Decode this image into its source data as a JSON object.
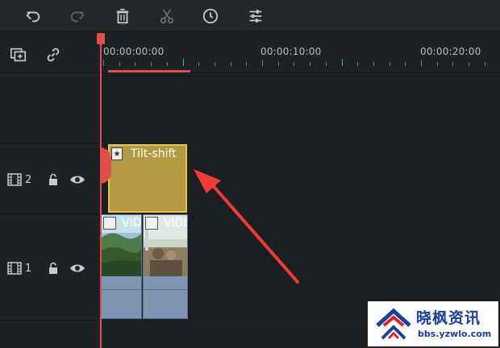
{
  "toolbar": {
    "buttons": [
      {
        "name": "undo-icon"
      },
      {
        "name": "redo-icon"
      },
      {
        "name": "delete-icon"
      },
      {
        "name": "cut-icon"
      },
      {
        "name": "duration-icon"
      },
      {
        "name": "adjust-icon"
      }
    ]
  },
  "timeline": {
    "timecodes": [
      "00:00:00:00",
      "00:00:10:00",
      "00:00:20:00"
    ],
    "tracks": [
      {
        "number": "2"
      },
      {
        "number": "1"
      }
    ],
    "effect_clip": {
      "label": "Tilt-shift"
    },
    "video_clips": [
      {
        "label": "VIDEO"
      },
      {
        "label": "VIDEO"
      }
    ]
  },
  "watermark": {
    "title": "晓枫资讯",
    "url": "bbs.yzwlo.com"
  },
  "colors": {
    "playhead": "#e0504a",
    "effect_clip": "#b49a43",
    "video_clip": "#8197b6"
  }
}
